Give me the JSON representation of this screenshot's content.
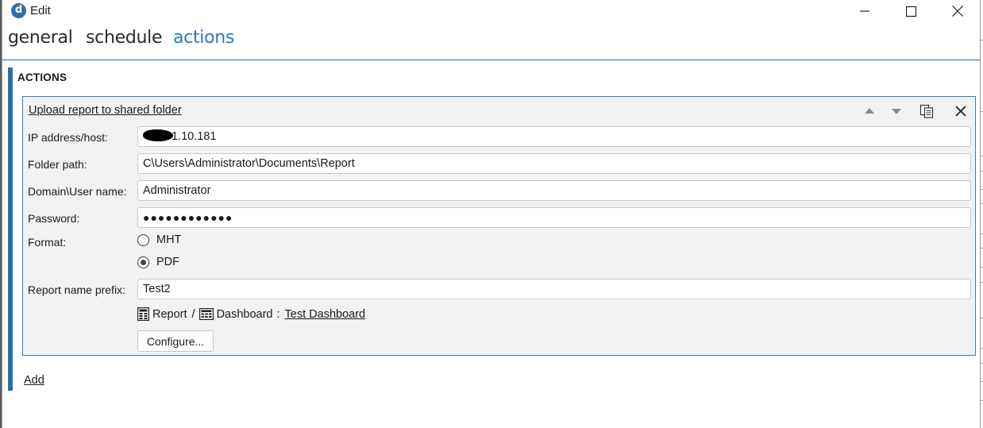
{
  "window": {
    "app_icon_letter": "d",
    "title": "Edit"
  },
  "tabs": [
    {
      "label": "general",
      "active": false
    },
    {
      "label": "schedule",
      "active": false
    },
    {
      "label": "actions",
      "active": true
    }
  ],
  "section": {
    "heading": "ACTIONS"
  },
  "action": {
    "title": "Upload report to shared folder",
    "toolbar_icons": [
      "move-up-icon",
      "move-down-icon",
      "copy-icon",
      "close-icon"
    ],
    "fields": {
      "ip_label": "IP address/host:",
      "ip_value_visible": "1.10.181",
      "folder_label": "Folder path:",
      "folder_value": "C\\Users\\Administrator\\Documents\\Report",
      "user_label": "Domain\\User name:",
      "user_value": "Administrator",
      "password_label": "Password:",
      "password_mask": "●●●●●●●●●●●●",
      "format_label": "Format:",
      "format_options": [
        {
          "label": "MHT",
          "selected": false
        },
        {
          "label": "PDF",
          "selected": true
        }
      ],
      "prefix_label": "Report name prefix:",
      "prefix_value": "Test2"
    },
    "source": {
      "report_label": "Report",
      "slash": "/",
      "dashboard_label": "Dashboard",
      "colon": ":",
      "dashboard_name": "Test Dashboard"
    },
    "configure_label": "Configure..."
  },
  "add_label": "Add",
  "colors": {
    "accent": "#2a6fa6",
    "active_tab": "#2a7ab9",
    "panel_bg": "#f2f2f2",
    "panel_border": "#3b7db5"
  }
}
